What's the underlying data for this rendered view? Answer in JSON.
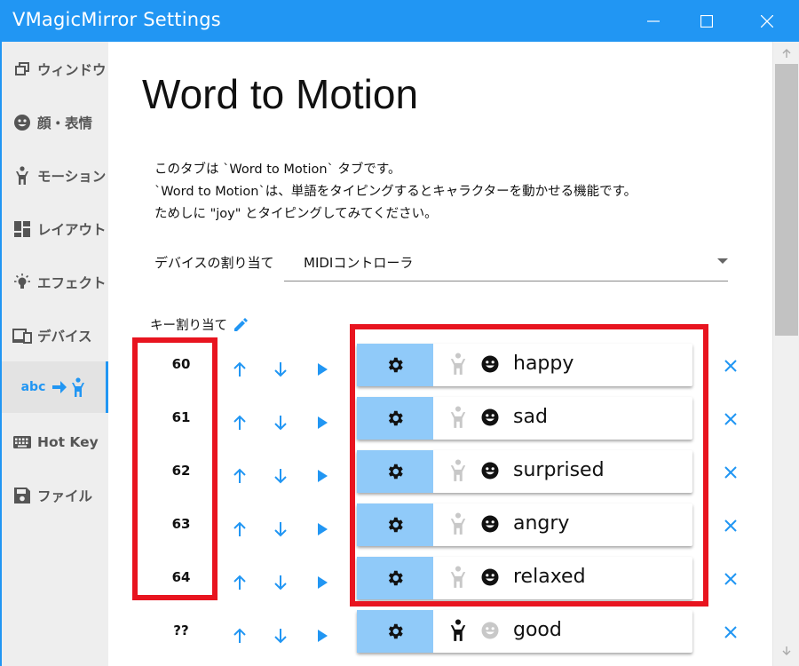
{
  "window": {
    "title": "VMagicMirror Settings"
  },
  "colors": {
    "accent": "#2196f3",
    "gear_bg": "#90caf9",
    "highlight": "#e8141f"
  },
  "sidebar": {
    "items": [
      {
        "label": "ウィンドウ",
        "icon": "window-icon"
      },
      {
        "label": "顔・表情",
        "icon": "face-icon"
      },
      {
        "label": "モーション",
        "icon": "person-icon"
      },
      {
        "label": "レイアウト",
        "icon": "layout-icon"
      },
      {
        "label": "エフェクト",
        "icon": "lightbulb-icon"
      },
      {
        "label": "デバイス",
        "icon": "devices-icon"
      },
      {
        "label": "abc",
        "icon": "word-to-motion-icon",
        "active": true
      },
      {
        "label": "Hot Key",
        "icon": "keyboard-icon"
      },
      {
        "label": "ファイル",
        "icon": "save-icon"
      }
    ]
  },
  "main": {
    "title": "Word to Motion",
    "description": [
      "このタブは `Word to Motion` タブです。",
      "`Word to Motion`は、単語をタイピングするとキャラクターを動かせる機能です。",
      "ためしに \"joy\" とタイピングしてみてください。"
    ],
    "device_label": "デバイスの割り当て",
    "device_value": "MIDIコントローラ",
    "key_assign_label": "キー割り当て",
    "rows": [
      {
        "key": "60",
        "word": "happy",
        "body_enabled": false,
        "face_enabled": true
      },
      {
        "key": "61",
        "word": "sad",
        "body_enabled": false,
        "face_enabled": true
      },
      {
        "key": "62",
        "word": "surprised",
        "body_enabled": false,
        "face_enabled": true
      },
      {
        "key": "63",
        "word": "angry",
        "body_enabled": false,
        "face_enabled": true
      },
      {
        "key": "64",
        "word": "relaxed",
        "body_enabled": false,
        "face_enabled": true
      },
      {
        "key": "??",
        "word": "good",
        "body_enabled": true,
        "face_enabled": false
      }
    ]
  }
}
